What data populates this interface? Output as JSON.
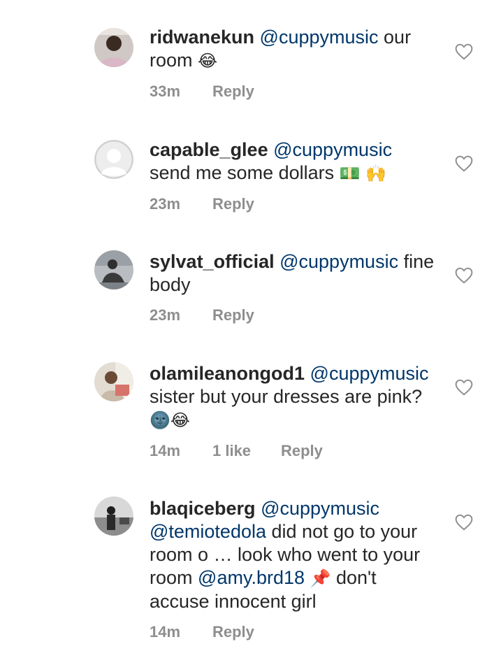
{
  "comments": [
    {
      "username": "ridwanekun",
      "mention": "@cuppymusic",
      "body": "our room",
      "emoji": "😂",
      "time": "33m",
      "likes": "",
      "reply": "Reply"
    },
    {
      "username": "capable_glee",
      "mention": "@cuppymusic",
      "body": "send me some dollars",
      "emoji": "💵 🙌",
      "time": "23m",
      "likes": "",
      "reply": "Reply"
    },
    {
      "username": "sylvat_official",
      "mention": "@cuppymusic",
      "body": "fine body",
      "emoji": "",
      "time": "23m",
      "likes": "",
      "reply": "Reply"
    },
    {
      "username": "olamileanongod1",
      "mention": "@cuppymusic",
      "body": "sister but your dresses are pink?",
      "emoji": "🌚😂",
      "time": "14m",
      "likes": "1 like",
      "reply": "Reply"
    },
    {
      "username": "blaqiceberg",
      "mention": "@cuppymusic",
      "mention2": "@temiotedola",
      "body": "did not go to your room o … look who went to your room",
      "mention3": "@amy.brd18",
      "emoji": "📌",
      "body2": "don't accuse innocent girl",
      "time": "14m",
      "likes": "",
      "reply": "Reply"
    }
  ],
  "icons": {
    "like": "heart-outline-icon",
    "avatar_placeholder": "default-avatar-icon"
  },
  "colors": {
    "text": "#262626",
    "mention": "#00376b",
    "meta": "#8e8e8e"
  }
}
